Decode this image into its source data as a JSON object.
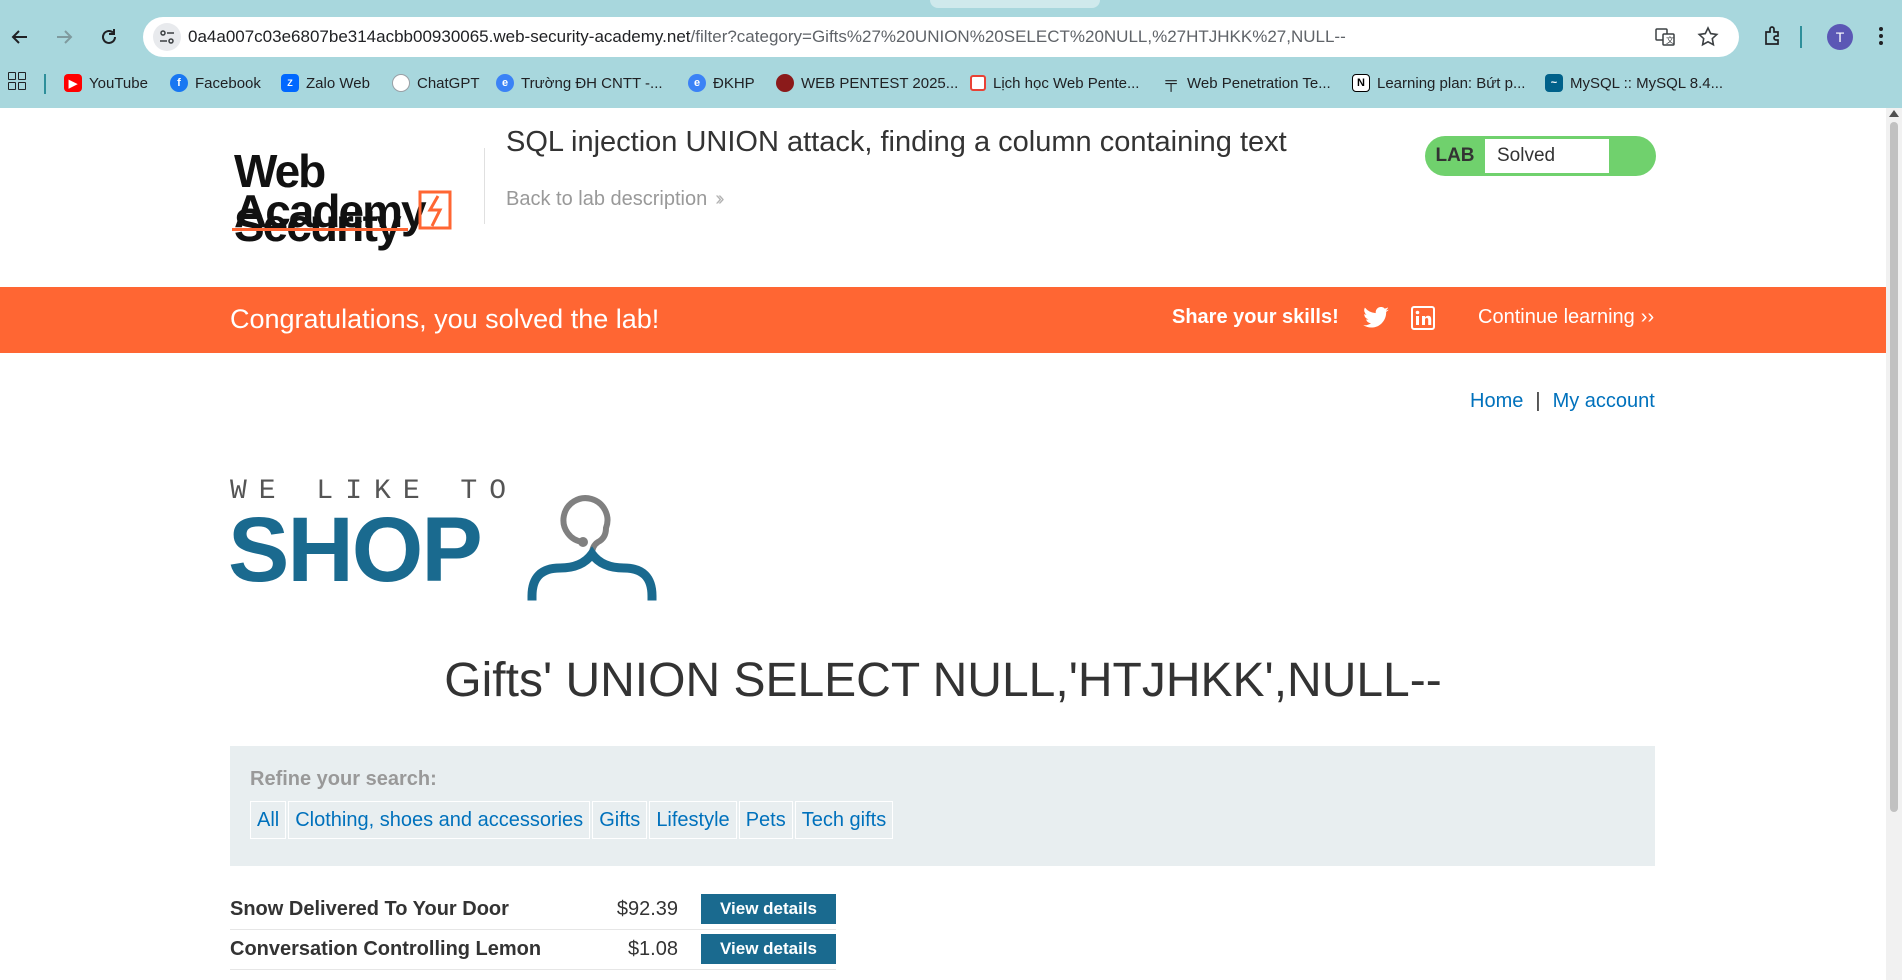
{
  "browser": {
    "url_host": "0a4a007c03e6807be314acbb00930065.web-security-academy.net",
    "url_path": "/filter?category=Gifts%27%20UNION%20SELECT%20NULL,%27HTJHKK%27,NULL--",
    "profile_initial": "T",
    "bookmarks": [
      {
        "label": "YouTube",
        "icon": "youtube-icon",
        "color": "#ff0000"
      },
      {
        "label": "Facebook",
        "icon": "facebook-icon",
        "color": "#1877f2"
      },
      {
        "label": "Zalo Web",
        "icon": "zalo-icon",
        "color": "#0068ff"
      },
      {
        "label": "ChatGPT",
        "icon": "chatgpt-icon",
        "color": "#9aa0a6"
      },
      {
        "label": "Trường ĐH CNTT -...",
        "icon": "edge-icon",
        "color": "#3b82f6"
      },
      {
        "label": "ĐKHP",
        "icon": "edge-icon",
        "color": "#3b82f6"
      },
      {
        "label": "WEB PENTEST 2025...",
        "icon": "avatar-icon",
        "color": "#8b1a1a"
      },
      {
        "label": "Lịch học Web Pente...",
        "icon": "calendar-icon",
        "color": "#e94235"
      },
      {
        "label": "Web Penetration Te...",
        "icon": "pin-icon",
        "color": "#202124"
      },
      {
        "label": "Learning plan: Bứt p...",
        "icon": "notion-icon",
        "color": "#000000"
      },
      {
        "label": "MySQL :: MySQL 8.4...",
        "icon": "mysql-icon",
        "color": "#00618a"
      }
    ]
  },
  "header": {
    "logo_line1": "Web Security",
    "logo_line2": "Academy",
    "lab_title": "SQL injection UNION attack, finding a column containing text",
    "back_link": "Back to lab description",
    "lab_label": "LAB",
    "lab_status": "Solved"
  },
  "banner": {
    "message": "Congratulations, you solved the lab!",
    "share": "Share your skills!",
    "continue": "Continue learning"
  },
  "nav": {
    "home": "Home",
    "separator": "|",
    "account": "My account"
  },
  "shop_logo": {
    "tagline": "WE LIKE TO",
    "word": "SHOP"
  },
  "heading": "Gifts' UNION SELECT NULL,'HTJHKK',NULL--",
  "filters": {
    "label": "Refine your search:",
    "items": [
      "All",
      "Clothing, shoes and accessories",
      "Gifts",
      "Lifestyle",
      "Pets",
      "Tech gifts"
    ]
  },
  "products": [
    {
      "name": "Snow Delivered To Your Door",
      "price": "$92.39",
      "button": "View details"
    },
    {
      "name": "Conversation Controlling Lemon",
      "price": "$1.08",
      "button": "View details"
    }
  ],
  "colors": {
    "chrome": "#a8d7dd",
    "banner": "#ff6633",
    "link": "#0071bc",
    "shop_blue": "#1a6a8f",
    "lab_green": "#70d16d"
  }
}
